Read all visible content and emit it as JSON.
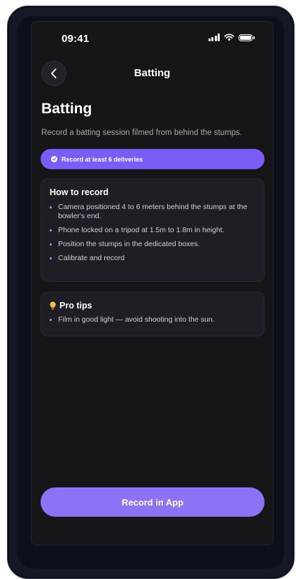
{
  "status_bar": {
    "time": "09:41"
  },
  "nav": {
    "title": "Batting"
  },
  "page": {
    "title": "Batting",
    "subtitle": "Record a batting session filmed from behind the stumps."
  },
  "badge": {
    "text": "Record at least 6 deliveries",
    "color": "#7b5cf6"
  },
  "how_to_record": {
    "title": "How to record",
    "items": [
      "Camera positioned 4 to 6 meters behind the stumps at the bowler's end.",
      "Phone locked on a tripod at 1.5m to 1.8m in height.",
      "Position the stumps in the dedicated boxes.",
      "Calibrate and record"
    ]
  },
  "pro_tips": {
    "icon": "lightbulb-icon",
    "title": "Pro tips",
    "items": [
      "Film in good light — avoid shooting into the sun."
    ]
  },
  "cta": {
    "label": "Record in App",
    "color": "#8d72f5"
  },
  "colors": {
    "background": "#161518",
    "card": "#1f1e25",
    "accent": "#7b5cf6"
  }
}
